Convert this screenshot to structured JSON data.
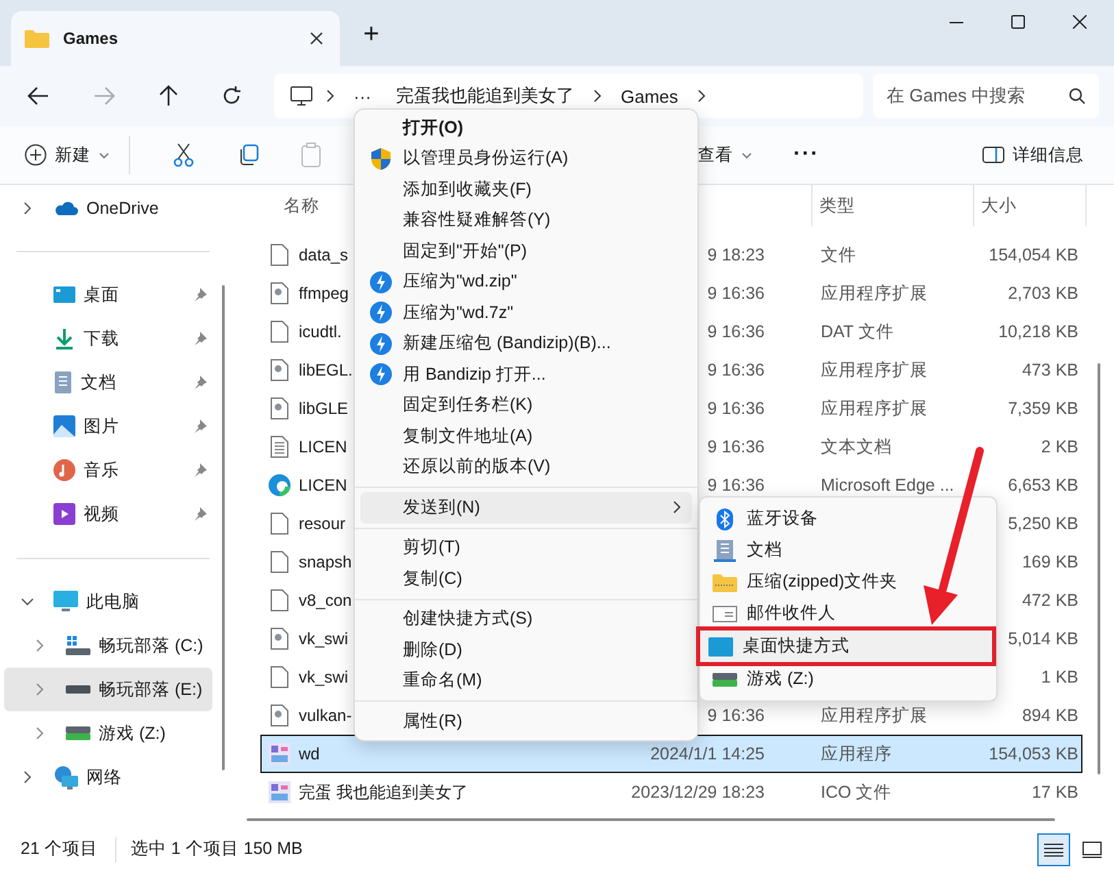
{
  "window": {
    "tab_title": "Games",
    "new_tab": "+"
  },
  "address_bar": {
    "overflow": "···",
    "crumbs": [
      "完蛋我也能追到美女了",
      "Games"
    ],
    "search": {
      "placeholder": "在 Games 中搜索"
    }
  },
  "toolbar": {
    "new": "新建",
    "view": "查看",
    "more": "···",
    "details": "详细信息"
  },
  "sidebar": {
    "locations": [
      {
        "label": "OneDrive",
        "kind": "cloud",
        "expanded": false
      }
    ],
    "quick_access": [
      {
        "label": "桌面",
        "kind": "desktop",
        "pinned": true
      },
      {
        "label": "下载",
        "kind": "download",
        "pinned": true
      },
      {
        "label": "文档",
        "kind": "documents",
        "pinned": true
      },
      {
        "label": "图片",
        "kind": "pictures",
        "pinned": true
      },
      {
        "label": "音乐",
        "kind": "music",
        "pinned": true
      },
      {
        "label": "视频",
        "kind": "videos",
        "pinned": true
      }
    ],
    "devices": [
      {
        "label": "此电脑",
        "kind": "computer",
        "expanded": true,
        "selected": false,
        "children": [
          {
            "label": "畅玩部落 (C:)",
            "kind": "system-drive",
            "expanded": false,
            "selected": false
          },
          {
            "label": "畅玩部落 (E:)",
            "kind": "drive",
            "expanded": false,
            "selected": true
          },
          {
            "label": "游戏 (Z:)",
            "kind": "green-drive",
            "expanded": false,
            "selected": false
          }
        ]
      },
      {
        "label": "网络",
        "kind": "network",
        "expanded": false,
        "selected": false
      }
    ]
  },
  "file_list": {
    "columns": {
      "name": "名称",
      "type": "类型",
      "size": "大小"
    },
    "rows": [
      {
        "name": "data_s",
        "date": "9 18:23",
        "type": "文件",
        "size": "154,054 KB",
        "kind": "blank",
        "selected": false
      },
      {
        "name": "ffmpeg",
        "date": "9 16:36",
        "type": "应用程序扩展",
        "size": "2,703 KB",
        "kind": "dll",
        "selected": false
      },
      {
        "name": "icudtl.",
        "date": "9 16:36",
        "type": "DAT 文件",
        "size": "10,218 KB",
        "kind": "blank",
        "selected": false
      },
      {
        "name": "libEGL.",
        "date": "9 16:36",
        "type": "应用程序扩展",
        "size": "473 KB",
        "kind": "dll",
        "selected": false
      },
      {
        "name": "libGLE",
        "date": "9 16:36",
        "type": "应用程序扩展",
        "size": "7,359 KB",
        "kind": "dll",
        "selected": false
      },
      {
        "name": "LICEN",
        "date": "9 16:36",
        "type": "文本文档",
        "size": "2 KB",
        "kind": "text",
        "selected": false
      },
      {
        "name": "LICEN",
        "date": "9 16:36",
        "type": "Microsoft Edge ...",
        "size": "6,653 KB",
        "kind": "edge",
        "selected": false
      },
      {
        "name": "resour",
        "size": "5,250 KB",
        "kind": "blank",
        "selected": false
      },
      {
        "name": "snapsh",
        "size": "169 KB",
        "kind": "blank",
        "selected": false
      },
      {
        "name": "v8_con",
        "size": "472 KB",
        "kind": "blank",
        "selected": false
      },
      {
        "name": "vk_swi",
        "size": "5,014 KB",
        "kind": "dll",
        "selected": false
      },
      {
        "name": "vk_swi",
        "size": "1 KB",
        "kind": "blank",
        "selected": false
      },
      {
        "name": "vulkan-",
        "date": "9 16:36",
        "type": "应用程序扩展",
        "size": "894 KB",
        "kind": "dll",
        "selected": false
      },
      {
        "name": "wd",
        "date": "2024/1/1 14:25",
        "type": "应用程序",
        "size": "154,053 KB",
        "kind": "app",
        "selected": true
      },
      {
        "name": "完蛋 我也能追到美女了",
        "date": "2023/12/29 18:23",
        "type": "ICO 文件",
        "size": "17 KB",
        "kind": "app",
        "selected": false
      }
    ]
  },
  "context_menu": {
    "groups": [
      [
        {
          "label": "打开(O)",
          "kind": "default",
          "selected": false
        },
        {
          "label": "以管理员身份运行(A)",
          "kind": "admin",
          "selected": false
        },
        {
          "label": "添加到收藏夹(F)",
          "kind": "plain",
          "selected": false
        },
        {
          "label": "兼容性疑难解答(Y)",
          "kind": "plain",
          "selected": false
        },
        {
          "label": "固定到\"开始\"(P)",
          "kind": "plain",
          "selected": false
        },
        {
          "label": "压缩为\"wd.zip\"",
          "kind": "archive",
          "selected": false
        },
        {
          "label": "压缩为\"wd.7z\"",
          "kind": "archive",
          "selected": false
        },
        {
          "label": "新建压缩包 (Bandizip)(B)...",
          "kind": "archive",
          "selected": false
        },
        {
          "label": "用 Bandizip 打开...",
          "kind": "archive",
          "selected": false
        },
        {
          "label": "固定到任务栏(K)",
          "kind": "plain",
          "selected": false
        },
        {
          "label": "复制文件地址(A)",
          "kind": "plain",
          "selected": false
        },
        {
          "label": "还原以前的版本(V)",
          "kind": "plain",
          "selected": false
        }
      ],
      [
        {
          "label": "发送到(N)",
          "kind": "submenu",
          "selected": true
        }
      ],
      [
        {
          "label": "剪切(T)",
          "kind": "plain",
          "selected": false
        },
        {
          "label": "复制(C)",
          "kind": "plain",
          "selected": false
        }
      ],
      [
        {
          "label": "创建快捷方式(S)",
          "kind": "plain",
          "selected": false
        },
        {
          "label": "删除(D)",
          "kind": "plain",
          "selected": false
        },
        {
          "label": "重命名(M)",
          "kind": "plain",
          "selected": false
        }
      ],
      [
        {
          "label": "属性(R)",
          "kind": "plain",
          "selected": false
        }
      ]
    ]
  },
  "send_to_menu": {
    "items": [
      {
        "label": "蓝牙设备",
        "kind": "bluetooth",
        "selected": false
      },
      {
        "label": "文档",
        "kind": "documents",
        "selected": false
      },
      {
        "label": "压缩(zipped)文件夹",
        "kind": "zip-folder",
        "selected": false
      },
      {
        "label": "邮件收件人",
        "kind": "mail",
        "selected": false
      },
      {
        "label": "桌面快捷方式",
        "kind": "desktop",
        "selected": true
      },
      {
        "label": "游戏 (Z:)",
        "kind": "drive",
        "selected": false
      }
    ]
  },
  "status_bar": {
    "count": "21 个项目",
    "selection": "选中 1 个项目  150 MB",
    "view_modes": [
      {
        "kind": "details",
        "selected": true
      },
      {
        "kind": "tiles",
        "selected": false
      }
    ]
  }
}
